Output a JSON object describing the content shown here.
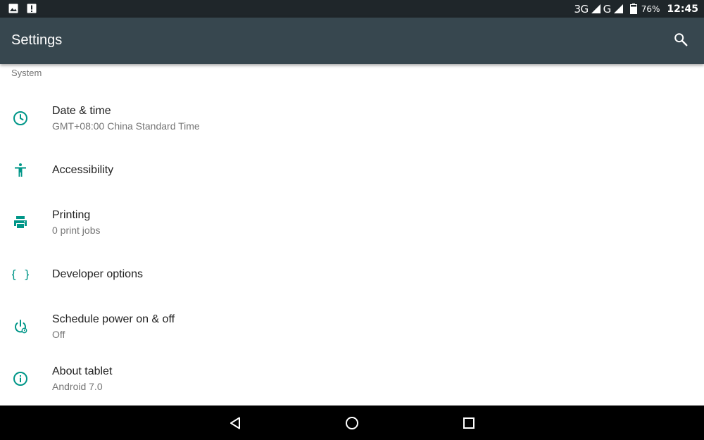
{
  "status_bar": {
    "network_3g": "3G",
    "network_g": "G",
    "battery_percent": "76%",
    "time": "12:45",
    "left_icons": [
      "image-notification-icon",
      "alert-notification-icon"
    ]
  },
  "app_bar": {
    "title": "Settings",
    "search_icon": "search-icon"
  },
  "section": {
    "header": "System"
  },
  "items": [
    {
      "title": "Date & time",
      "subtitle": "GMT+08:00 China Standard Time",
      "icon": "clock-icon"
    },
    {
      "title": "Accessibility",
      "subtitle": "",
      "icon": "accessibility-icon"
    },
    {
      "title": "Printing",
      "subtitle": "0 print jobs",
      "icon": "printer-icon"
    },
    {
      "title": "Developer options",
      "subtitle": "",
      "icon": "braces-icon"
    },
    {
      "title": "Schedule power on & off",
      "subtitle": "Off",
      "icon": "power-schedule-icon"
    },
    {
      "title": "About tablet",
      "subtitle": "Android 7.0",
      "icon": "info-icon"
    }
  ],
  "nav_bar": {
    "icons": [
      "back-icon",
      "home-icon",
      "recents-icon"
    ]
  },
  "colors": {
    "status_bar": "#1f262a",
    "app_bar": "#37474f",
    "accent": "#009688",
    "text_primary": "#212121",
    "text_secondary": "#757575"
  }
}
